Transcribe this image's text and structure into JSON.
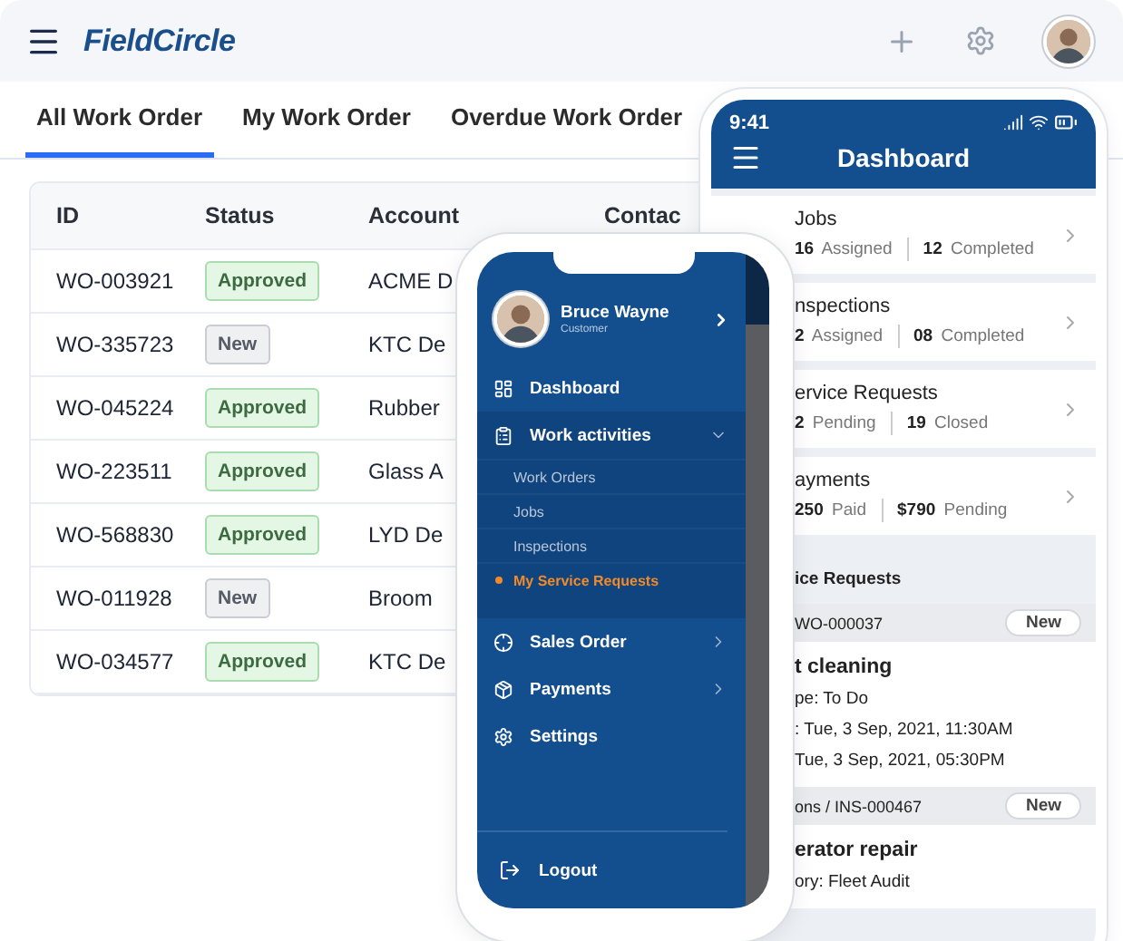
{
  "app": {
    "logo": "FieldCircle"
  },
  "tabs": [
    {
      "label": "All Work Order",
      "selected": true
    },
    {
      "label": "My Work Order",
      "selected": false
    },
    {
      "label": "Overdue Work Order",
      "selected": false
    }
  ],
  "table": {
    "columns": [
      "ID",
      "Status",
      "Account",
      "Contac"
    ],
    "rows": [
      {
        "id": "WO-003921",
        "status": "Approved",
        "kind": "approved",
        "account": "ACME D"
      },
      {
        "id": "WO-335723",
        "status": "New",
        "kind": "new",
        "account": "KTC De"
      },
      {
        "id": "WO-045224",
        "status": "Approved",
        "kind": "approved",
        "account": "Rubber"
      },
      {
        "id": "WO-223511",
        "status": "Approved",
        "kind": "approved",
        "account": "Glass A"
      },
      {
        "id": "WO-568830",
        "status": "Approved",
        "kind": "approved",
        "account": "LYD De"
      },
      {
        "id": "WO-011928",
        "status": "New",
        "kind": "new",
        "account": "Broom"
      },
      {
        "id": "WO-034577",
        "status": "Approved",
        "kind": "approved",
        "account": "KTC De"
      }
    ]
  },
  "dashboard_phone": {
    "time": "9:41",
    "title": "Dashboard",
    "summaries": [
      {
        "title": "Jobs",
        "stats": [
          "**16** Assigned",
          "**12** Completed"
        ]
      },
      {
        "title": "nspections",
        "stats": [
          "**2** Assigned",
          "**08** Completed"
        ]
      },
      {
        "title": "ervice Requests",
        "stats": [
          "**2** Pending",
          "**19** Closed"
        ]
      },
      {
        "title": "ayments",
        "stats": [
          "**250** Paid",
          "**$790** Pending"
        ]
      }
    ],
    "section_title": "ice Requests",
    "requests": [
      {
        "ref": "WO-000037",
        "badge": "New",
        "title": "t cleaning",
        "lines": [
          "pe: To Do",
          ": Tue, 3 Sep, 2021, 11:30AM",
          "Tue, 3 Sep, 2021, 05:30PM"
        ]
      },
      {
        "ref": "ons /  INS-000467",
        "badge": "New",
        "title": "erator repair",
        "lines": [
          "ory: Fleet Audit"
        ]
      }
    ]
  },
  "menu_phone": {
    "user": {
      "name": "Bruce Wayne",
      "role": "Customer"
    },
    "items": [
      {
        "label": "Dashboard"
      },
      {
        "label": "Work activities",
        "expanded": true,
        "children": [
          {
            "label": "Work Orders",
            "selected": false
          },
          {
            "label": "Jobs",
            "selected": false
          },
          {
            "label": "Inspections",
            "selected": false
          },
          {
            "label": "My Service Requests",
            "selected": true
          }
        ]
      },
      {
        "label": "Sales Order",
        "expanded": false
      },
      {
        "label": "Payments",
        "expanded": false
      },
      {
        "label": "Settings"
      }
    ],
    "logout": "Logout"
  }
}
